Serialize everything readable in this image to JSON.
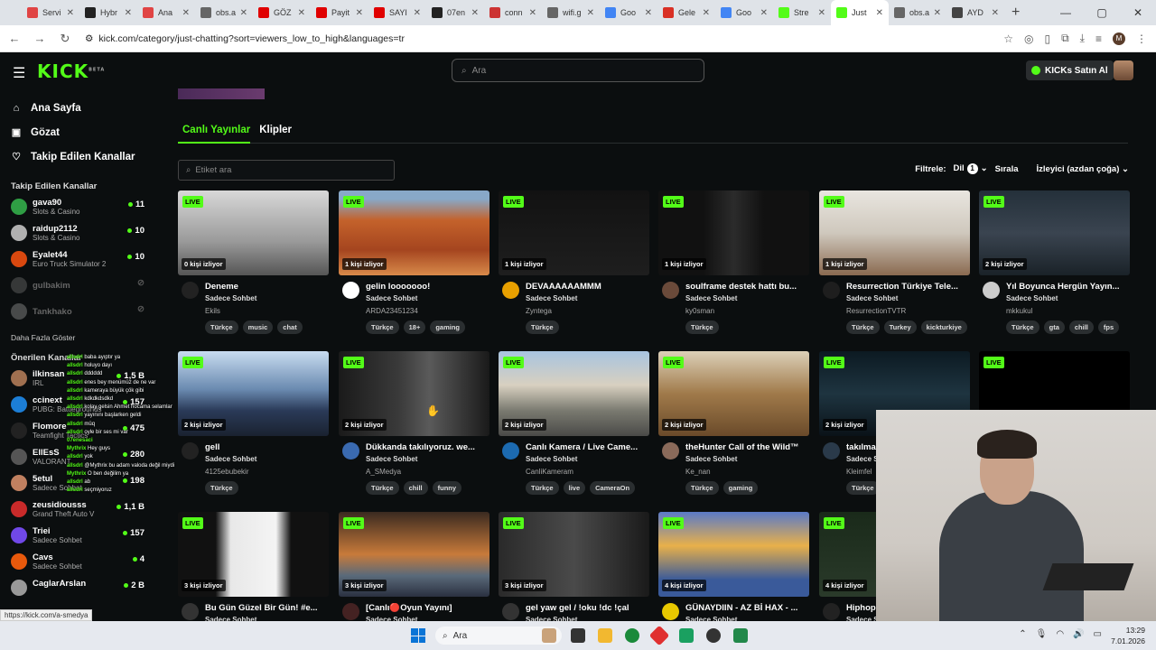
{
  "browser": {
    "tabs": [
      {
        "label": "Servi",
        "color": "#e04444"
      },
      {
        "label": "Hybr",
        "color": "#222222"
      },
      {
        "label": "Ana",
        "color": "#e04444"
      },
      {
        "label": "obs.a",
        "color": "#666666"
      },
      {
        "label": "GÖZ",
        "color": "#e00000"
      },
      {
        "label": "Payit",
        "color": "#e00000"
      },
      {
        "label": "SAYI",
        "color": "#e00000"
      },
      {
        "label": "07en",
        "color": "#222222"
      },
      {
        "label": "conn",
        "color": "#cc3333"
      },
      {
        "label": "wifi.g",
        "color": "#666666"
      },
      {
        "label": "Goo",
        "color": "#4285f4"
      },
      {
        "label": "Gele",
        "color": "#d93025"
      },
      {
        "label": "Goo",
        "color": "#4285f4"
      },
      {
        "label": "Stre",
        "color": "#53fc18"
      },
      {
        "label": "Just",
        "color": "#53fc18"
      },
      {
        "label": "obs.a",
        "color": "#666666"
      },
      {
        "label": "AYD",
        "color": "#444444"
      }
    ],
    "url": "kick.com/category/just-chatting?sort=viewers_low_to_high&languages=tr",
    "profile_initial": "M",
    "status_url": "https://kick.com/a-smedya"
  },
  "header": {
    "logo": "KICK",
    "logo_beta": "BETA",
    "search_placeholder": "Ara",
    "buy_kicks": "KICKs Satın Al"
  },
  "sidebar": {
    "nav": [
      {
        "label": "Ana Sayfa",
        "icon": "home-icon",
        "glyph": "⌂"
      },
      {
        "label": "Gözat",
        "icon": "browse-icon",
        "glyph": "▣"
      },
      {
        "label": "Takip Edilen Kanallar",
        "icon": "heart-icon",
        "glyph": "♡"
      }
    ],
    "following_title": "Takip Edilen Kanallar",
    "following": [
      {
        "name": "gava90",
        "category": "Slots & Casino",
        "viewers": "11",
        "color": "#2f9e44"
      },
      {
        "name": "raidup2112",
        "category": "Slots & Casino",
        "viewers": "10",
        "color": "#b0b0b0"
      },
      {
        "name": "Eyalet44",
        "category": "Euro Truck Simulator 2",
        "viewers": "10",
        "color": "#d9480f"
      },
      {
        "name": "gulbakim",
        "category": "",
        "viewers": "",
        "color": "#888888"
      },
      {
        "name": "Tankhako",
        "category": "",
        "viewers": "",
        "color": "#bbbbbb"
      }
    ],
    "more": "Daha Fazla Göster",
    "recommended_title": "Önerilen Kanallar",
    "recommended": [
      {
        "name": "ilkinsan",
        "category": "IRL",
        "viewers": "1,5 B",
        "color": "#a07050"
      },
      {
        "name": "ccinext",
        "category": "PUBG: Battlegrounds",
        "viewers": "157",
        "color": "#1c7ed6"
      },
      {
        "name": "Flomore",
        "category": "Teamfight Tactics",
        "viewers": "475",
        "color": "#222222"
      },
      {
        "name": "EllEsS",
        "category": "VALORANT",
        "viewers": "280",
        "color": "#555555"
      },
      {
        "name": "5etul",
        "category": "Sadece Sohbet",
        "viewers": "198",
        "color": "#c08060"
      },
      {
        "name": "zeusidiousss",
        "category": "Grand Theft Auto V",
        "viewers": "1,1 B",
        "color": "#c92a2a"
      },
      {
        "name": "Triei",
        "category": "Sadece Sohbet",
        "viewers": "157",
        "color": "#7048e8"
      },
      {
        "name": "Cavs",
        "category": "Sadece Sohbet",
        "viewers": "4",
        "color": "#e8590c"
      },
      {
        "name": "CaglarArslan",
        "category": "",
        "viewers": "2 B",
        "color": "#999999"
      }
    ],
    "chat_overlay": [
      {
        "user": "allsdrl",
        "msg": "baba ayıptır ya"
      },
      {
        "user": "allsdrl",
        "msg": "holuyo dayı"
      },
      {
        "user": "allsdrl",
        "msg": "dddddd"
      },
      {
        "user": "allsdrl",
        "msg": "enes bey menümüz de ne var"
      },
      {
        "user": "allsdrl",
        "msg": "kameraya büyük çök gibi"
      },
      {
        "user": "allsdrl",
        "msg": "kdkdkdsdkd"
      },
      {
        "user": "allsdrl",
        "msg": "kolay gelsin Ahmet hocama selamlar"
      },
      {
        "user": "allsdrl",
        "msg": "yayınını başlarken geldi"
      },
      {
        "user": "allsdrl",
        "msg": "müq"
      },
      {
        "user": "allsdrl",
        "msg": "oyle bir ses mi var"
      },
      {
        "user": "07enesaci",
        "msg": ""
      },
      {
        "user": "Mythrix",
        "msg": "Hey guys"
      },
      {
        "user": "allsdrl",
        "msg": "yok"
      },
      {
        "user": "allsdrl",
        "msg": "@Mythrix bu adam valoda değil miydi"
      },
      {
        "user": "Mythrix",
        "msg": "O ben değilim ya"
      },
      {
        "user": "allsdrl",
        "msg": "ab"
      },
      {
        "user": "allsdrl",
        "msg": "seçmiyoruz"
      }
    ]
  },
  "main": {
    "tabs": [
      "Canlı Yayınlar",
      "Klipler"
    ],
    "tag_search_placeholder": "Etiket ara",
    "filter_label": "Filtrele:",
    "lang_label": "Dil",
    "lang_count": "1",
    "sort_label": "Sırala",
    "sort_value": "İzleyici (azdan çoğa)",
    "live_badge": "LIVE"
  },
  "cards": [
    {
      "viewers": "0 kişi izliyor",
      "title": "Deneme",
      "category": "Sadece Sohbet",
      "channel": "Ekils",
      "tags": [
        "Türkçe",
        "music",
        "chat"
      ],
      "bg": "linear-gradient(#d8d8d8,#9a9a9a 60%,#555)",
      "av": "#222222"
    },
    {
      "viewers": "1 kişi izliyor",
      "title": "gelin looooooo!",
      "category": "Sadece Sohbet",
      "channel": "ARDA23451234",
      "tags": [
        "Türkçe",
        "18+",
        "gaming"
      ],
      "bg": "linear-gradient(#88a8c8 10%,#c4622b 35%,#a5451f 70%,#d88a4a)",
      "av": "#ffffff"
    },
    {
      "viewers": "1 kişi izliyor",
      "title": "DEVAAAAAAMMM",
      "category": "Sadece Sohbet",
      "channel": "Zyntega",
      "tags": [
        "Türkçe"
      ],
      "bg": "linear-gradient(#121212,#1e1e1e)",
      "av": "#e8a000"
    },
    {
      "viewers": "1 kişi izliyor",
      "title": "soulframe destek hattı bu...",
      "category": "Sadece Sohbet",
      "channel": "ky0sman",
      "tags": [
        "Türkçe"
      ],
      "bg": "linear-gradient(90deg,#111 30%,#2b2b2b 50%,#111 70%)",
      "av": "#6a4a3a"
    },
    {
      "viewers": "1 kişi izliyor",
      "title": "Resurrection Türkiye Tele...",
      "category": "Sadece Sohbet",
      "channel": "ResurrectionTVTR",
      "tags": [
        "Türkçe",
        "Turkey",
        "kickturkiye"
      ],
      "bg": "linear-gradient(#e9e6e0,#cfc8bd 50%,#8a6a50)",
      "av": "#1e1e1e"
    },
    {
      "viewers": "2 kişi izliyor",
      "title": "Yıl Boyunca Hergün Yayın...",
      "category": "Sadece Sohbet",
      "channel": "mkkukul",
      "tags": [
        "Türkçe",
        "gta",
        "chill",
        "fps"
      ],
      "bg": "linear-gradient(#24303a,#3a4450 50%,#1a2228)",
      "av": "#cccccc"
    },
    {
      "viewers": "2 kişi izliyor",
      "title": "gell",
      "category": "Sadece Sohbet",
      "channel": "4125ebubekir",
      "tags": [
        "Türkçe"
      ],
      "bg": "linear-gradient(#c8dcf0,#6a8ab0 45%,#2a3a58 70%,#1a2230)",
      "av": "#222222"
    },
    {
      "viewers": "2 kişi izliyor",
      "title": "Dükkanda takılıyoruz. we...",
      "category": "Sadece Sohbet",
      "channel": "A_SMedya",
      "tags": [
        "Türkçe",
        "chill",
        "funny"
      ],
      "bg": "linear-gradient(90deg,#1a1a1a,#3a3a3a 40%,#5a5a5a 60%,#1a1a1a)",
      "av": "#3a6ab0"
    },
    {
      "viewers": "2 kişi izliyor",
      "title": "Canlı Kamera / Live Came...",
      "category": "Sadece Sohbet",
      "channel": "CanliKameram",
      "tags": [
        "Türkçe",
        "live",
        "CameraOn"
      ],
      "bg": "linear-gradient(#a8c4e0,#d8d0c0 40%,#7a7a70 70%,#4a4a48)",
      "av": "#1c6ab0"
    },
    {
      "viewers": "2 kişi izliyor",
      "title": "theHunter Call of the Wild™",
      "category": "Sadece Sohbet",
      "channel": "Ke_nan",
      "tags": [
        "Türkçe",
        "gaming"
      ],
      "bg": "linear-gradient(#dcd0b8,#a07a4a 50%,#6a4a2a)",
      "av": "#8a6a5a"
    },
    {
      "viewers": "2 kişi izliyor",
      "title": "takılmaca",
      "category": "Sadece Sohbet",
      "channel": "Kleimfel",
      "tags": [
        "Türkçe"
      ],
      "bg": "linear-gradient(#0c1a22,#1e3440 50%,#0a1218)",
      "av": "#2a3a4a"
    },
    {
      "viewers": "",
      "title": "",
      "category": "",
      "channel": "",
      "tags": [],
      "bg": "#000000",
      "av": "#000000"
    },
    {
      "viewers": "3 kişi izliyor",
      "title": "Bu Gün Güzel Bir Gün! #e...",
      "category": "Sadece Sohbet",
      "channel": "",
      "tags": [],
      "bg": "linear-gradient(90deg,#111 25%,#e8e8e8 35%,#f4f4f4 65%,#111 75%)",
      "av": "#333333"
    },
    {
      "viewers": "3 kişi izliyor",
      "title": "[Canlı🔴Oyun Yayını]",
      "category": "Sadece Sohbet",
      "channel": "",
      "tags": [],
      "bg": "linear-gradient(#3a2a20,#c87a3a 50%,#5a6a7a 75%,#2a3040)",
      "av": "#442222"
    },
    {
      "viewers": "3 kişi izliyor",
      "title": "gel yaw gel / !oku !dc !çal",
      "category": "Sadece Sohbet",
      "channel": "",
      "tags": [],
      "bg": "linear-gradient(90deg,#2a2a2a,#4a4a4a 50%,#1a1a1a)",
      "av": "#333333"
    },
    {
      "viewers": "4 kişi izliyor",
      "title": "GÜNAYDIIN - AZ Bİ HAX - ...",
      "category": "Sadece Sohbet",
      "channel": "",
      "tags": [],
      "bg": "linear-gradient(#5a7ac8,#e8b04a 40%,#3a5a9a 80%)",
      "av": "#e8c800"
    },
    {
      "viewers": "4 kişi izliyor",
      "title": "Hiphop",
      "category": "Sadece Sohbet",
      "channel": "",
      "tags": [],
      "bg": "linear-gradient(#1a2a1a,#2a3a2a)",
      "av": "#222222"
    }
  ],
  "taskbar": {
    "search": "Ara",
    "time": "13:29",
    "date": "7.01.2026"
  }
}
